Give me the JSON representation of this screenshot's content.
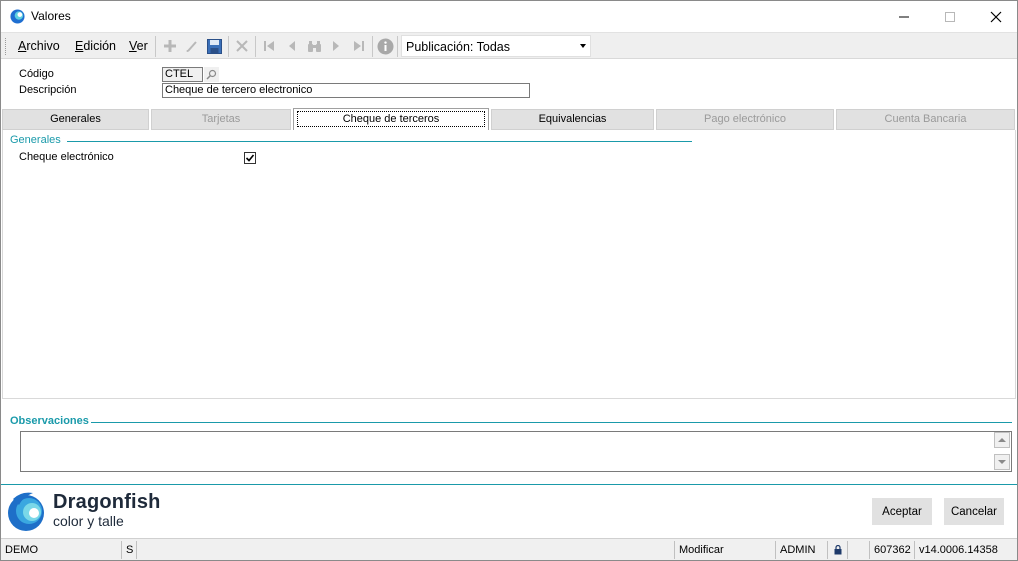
{
  "window": {
    "title": "Valores"
  },
  "menu": {
    "archivo": {
      "first": "A",
      "rest": "rchivo"
    },
    "edicion": {
      "first": "E",
      "rest": "dición"
    },
    "ver": {
      "first": "V",
      "rest": "er"
    }
  },
  "toolbar": {
    "icons": [
      "add-icon",
      "edit-icon",
      "save-icon",
      "delete-icon",
      "first-record-icon",
      "previous-record-icon",
      "find-icon",
      "next-record-icon",
      "last-record-icon",
      "info-icon"
    ],
    "publicacion": "Publicación: Todas"
  },
  "form": {
    "codigo_label": "Código",
    "codigo_value": "CTEL",
    "descripcion_label": "Descripción",
    "descripcion_value": "Cheque de tercero electronico"
  },
  "tabs": [
    {
      "label": "Generales",
      "state": "enabled"
    },
    {
      "label": "Tarjetas",
      "state": "disabled"
    },
    {
      "label": "Cheque de terceros",
      "state": "active"
    },
    {
      "label": "Equivalencias",
      "state": "enabled"
    },
    {
      "label": "Pago electrónico",
      "state": "disabled"
    },
    {
      "label": "Cuenta Bancaria",
      "state": "disabled"
    }
  ],
  "panel": {
    "group_title": "Generales",
    "cheque_electronico_label": "Cheque electrónico",
    "cheque_electronico_checked": true
  },
  "observaciones": {
    "title": "Observaciones",
    "value": ""
  },
  "brand": {
    "name": "Dragonfish",
    "sub": "color y talle"
  },
  "buttons": {
    "aceptar": "Aceptar",
    "cancelar": "Cancelar"
  },
  "statusbar": {
    "db": "DEMO",
    "flag": "S",
    "mode": "Modificar",
    "user": "ADMIN",
    "code": "607362",
    "version": "v14.0006.14358"
  },
  "colors": {
    "accent": "#1a9aaa",
    "brand": "#1e2a3a"
  }
}
